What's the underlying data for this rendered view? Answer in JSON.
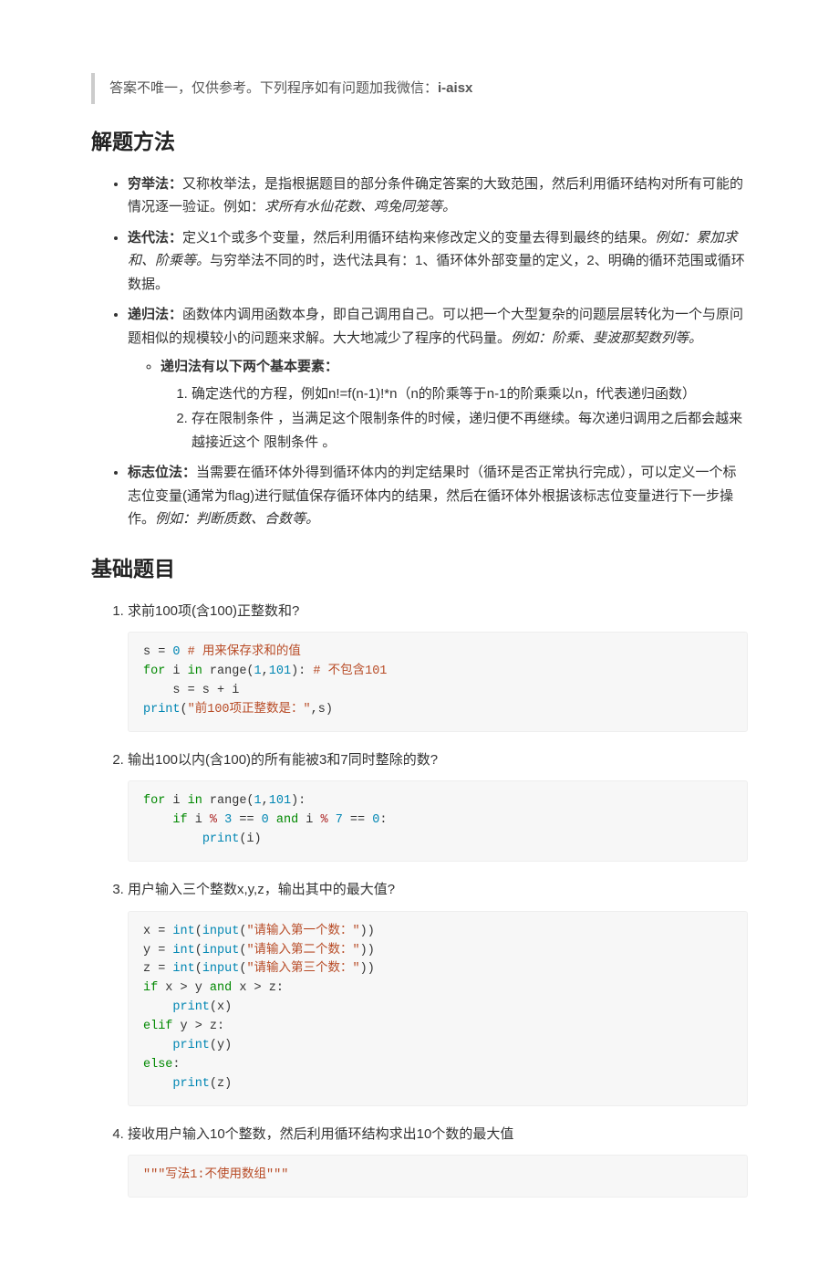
{
  "note": {
    "prefix": "答案不唯一，仅供参考。下列程序如有问题加我微信：",
    "handle": "i-aisx"
  },
  "section_methods_title": "解题方法",
  "methods": {
    "exhaustive": {
      "name": "穷举法：",
      "body1": "又称枚举法，是指根据题目的部分条件确定答案的大致范围，然后利用循环结构对所有可能的情况逐一验证。例如：",
      "example": "求所有水仙花数、鸡兔同笼等。"
    },
    "iterative": {
      "name": "迭代法：",
      "body1": "定义1个或多个变量，然后利用循环结构来修改定义的变量去得到最终的结果。",
      "example": "例如：累加求和、阶乘等。",
      "body2": "与穷举法不同的时，迭代法具有：1、循环体外部变量的定义，2、明确的循环范围或循环数据。"
    },
    "recursive": {
      "name": "递归法：",
      "body1": "函数体内调用函数本身，即自己调用自己。可以把一个大型复杂的问题层层转化为一个与原问题相似的规模较小的问题来求解。大大地减少了程序的代码量。",
      "example": "例如：阶乘、斐波那契数列等。",
      "sub_title": "递归法有以下两个基本要素：",
      "sub_items": [
        "确定迭代的方程，例如n!=f(n-1)!*n（n的阶乘等于n-1的阶乘乘以n，f代表递归函数）",
        "存在限制条件 ，当满足这个限制条件的时候，递归便不再继续。每次递归调用之后都会越来越接近这个 限制条件 。"
      ]
    },
    "flag": {
      "name": "标志位法：",
      "body1": "当需要在循环体外得到循环体内的判定结果时（循环是否正常执行完成），可以定义一个标志位变量(通常为flag)进行赋值保存循环体内的结果，然后在循环体外根据该标志位变量进行下一步操作。",
      "example": "例如：判断质数、合数等。"
    }
  },
  "section_basic_title": "基础题目",
  "problems": {
    "p1": {
      "text": "求前100项(含100)正整数和?"
    },
    "p2": {
      "text": "输出100以内(含100)的所有能被3和7同时整除的数?"
    },
    "p3": {
      "text": "用户输入三个整数x,y,z，输出其中的最大值?"
    },
    "p4": {
      "text": "接收用户输入10个整数，然后利用循环结构求出10个数的最大值"
    }
  },
  "code": {
    "c1": {
      "l1a": "s = ",
      "l1b": "0",
      "l1c": " # 用来保存求和的值",
      "l2a": "for",
      "l2b": " i ",
      "l2c": "in",
      "l2d": " range(",
      "l2e": "1",
      "l2f": ",",
      "l2g": "101",
      "l2h": "): ",
      "l2i": "# 不包含101",
      "l3": "    s = s + i",
      "l4a": "print",
      "l4b": "(",
      "l4c": "\"前100项正整数是：\"",
      "l4d": ",s)"
    },
    "c2": {
      "l1a": "for",
      "l1b": " i ",
      "l1c": "in",
      "l1d": " range(",
      "l1e": "1",
      "l1f": ",",
      "l1g": "101",
      "l1h": "):",
      "l2a": "    ",
      "l2b": "if",
      "l2c": " i ",
      "l2d": "%",
      "l2e": " ",
      "l2f": "3",
      "l2g": " == ",
      "l2h": "0",
      "l2i": " ",
      "l2j": "and",
      "l2k": " i ",
      "l2l": "%",
      "l2m": " ",
      "l2n": "7",
      "l2o": " == ",
      "l2p": "0",
      "l2q": ":",
      "l3a": "        ",
      "l3b": "print",
      "l3c": "(i)"
    },
    "c3": {
      "l1a": "x = ",
      "l1b": "int",
      "l1c": "(",
      "l1d": "input",
      "l1e": "(",
      "l1f": "\"请输入第一个数：\"",
      "l1g": "))",
      "l2a": "y = ",
      "l2b": "int",
      "l2c": "(",
      "l2d": "input",
      "l2e": "(",
      "l2f": "\"请输入第二个数：\"",
      "l2g": "))",
      "l3a": "z = ",
      "l3b": "int",
      "l3c": "(",
      "l3d": "input",
      "l3e": "(",
      "l3f": "\"请输入第三个数：\"",
      "l3g": "))",
      "l4a": "if",
      "l4b": " x > y ",
      "l4c": "and",
      "l4d": " x > z:",
      "l5a": "    ",
      "l5b": "print",
      "l5c": "(x)",
      "l6a": "elif",
      "l6b": " y > z:",
      "l7a": "    ",
      "l7b": "print",
      "l7c": "(y)",
      "l8a": "else",
      "l8b": ":",
      "l9a": "    ",
      "l9b": "print",
      "l9c": "(z)"
    },
    "c4": {
      "l1": "\"\"\"写法1:不使用数组\"\"\""
    }
  }
}
